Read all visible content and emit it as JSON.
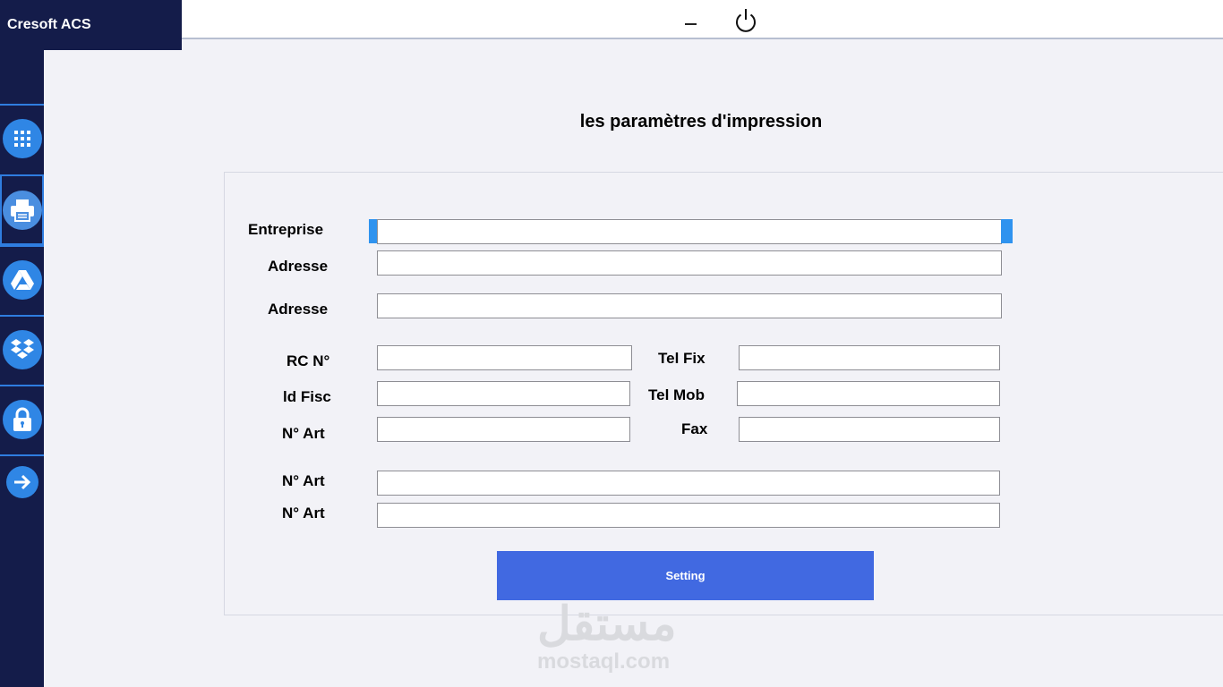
{
  "app": {
    "title": "Cresoft ACS"
  },
  "topbar": {
    "minimize_icon": "minimize-icon",
    "power_icon": "power-icon"
  },
  "sidebar": {
    "items": [
      {
        "name": "apps",
        "icon": "grid-icon"
      },
      {
        "name": "print",
        "icon": "printer-icon",
        "active": true
      },
      {
        "name": "drive",
        "icon": "google-drive-icon"
      },
      {
        "name": "dropbox",
        "icon": "dropbox-icon"
      },
      {
        "name": "lock",
        "icon": "lock-icon"
      },
      {
        "name": "exit",
        "icon": "arrow-right-icon"
      }
    ]
  },
  "page": {
    "title": "les paramètres d'impression"
  },
  "form": {
    "entreprise_label": "Entreprise",
    "adresse1_label": "Adresse",
    "adresse2_label": "Adresse",
    "rc_label": "RC N°",
    "idfisc_label": "ld Fisc",
    "nart1_label": "N° Art",
    "telfix_label": "Tel Fix",
    "telmob_label": "Tel Mob",
    "fax_label": "Fax",
    "nart2_label": "N° Art",
    "nart3_label": "N° Art",
    "values": {
      "entreprise": "",
      "adresse1": "",
      "adresse2": "",
      "rc": "",
      "idfisc": "",
      "nart1": "",
      "telfix": "",
      "telmob": "",
      "fax": "",
      "nart2": "",
      "nart3": ""
    }
  },
  "setting_button": {
    "label": "Setting"
  },
  "watermark": {
    "arabic": "مستقل",
    "latin": "mostaql.com"
  },
  "colors": {
    "sidebar": "#141c4a",
    "accent": "#2f86e5",
    "button": "#4169e1"
  }
}
